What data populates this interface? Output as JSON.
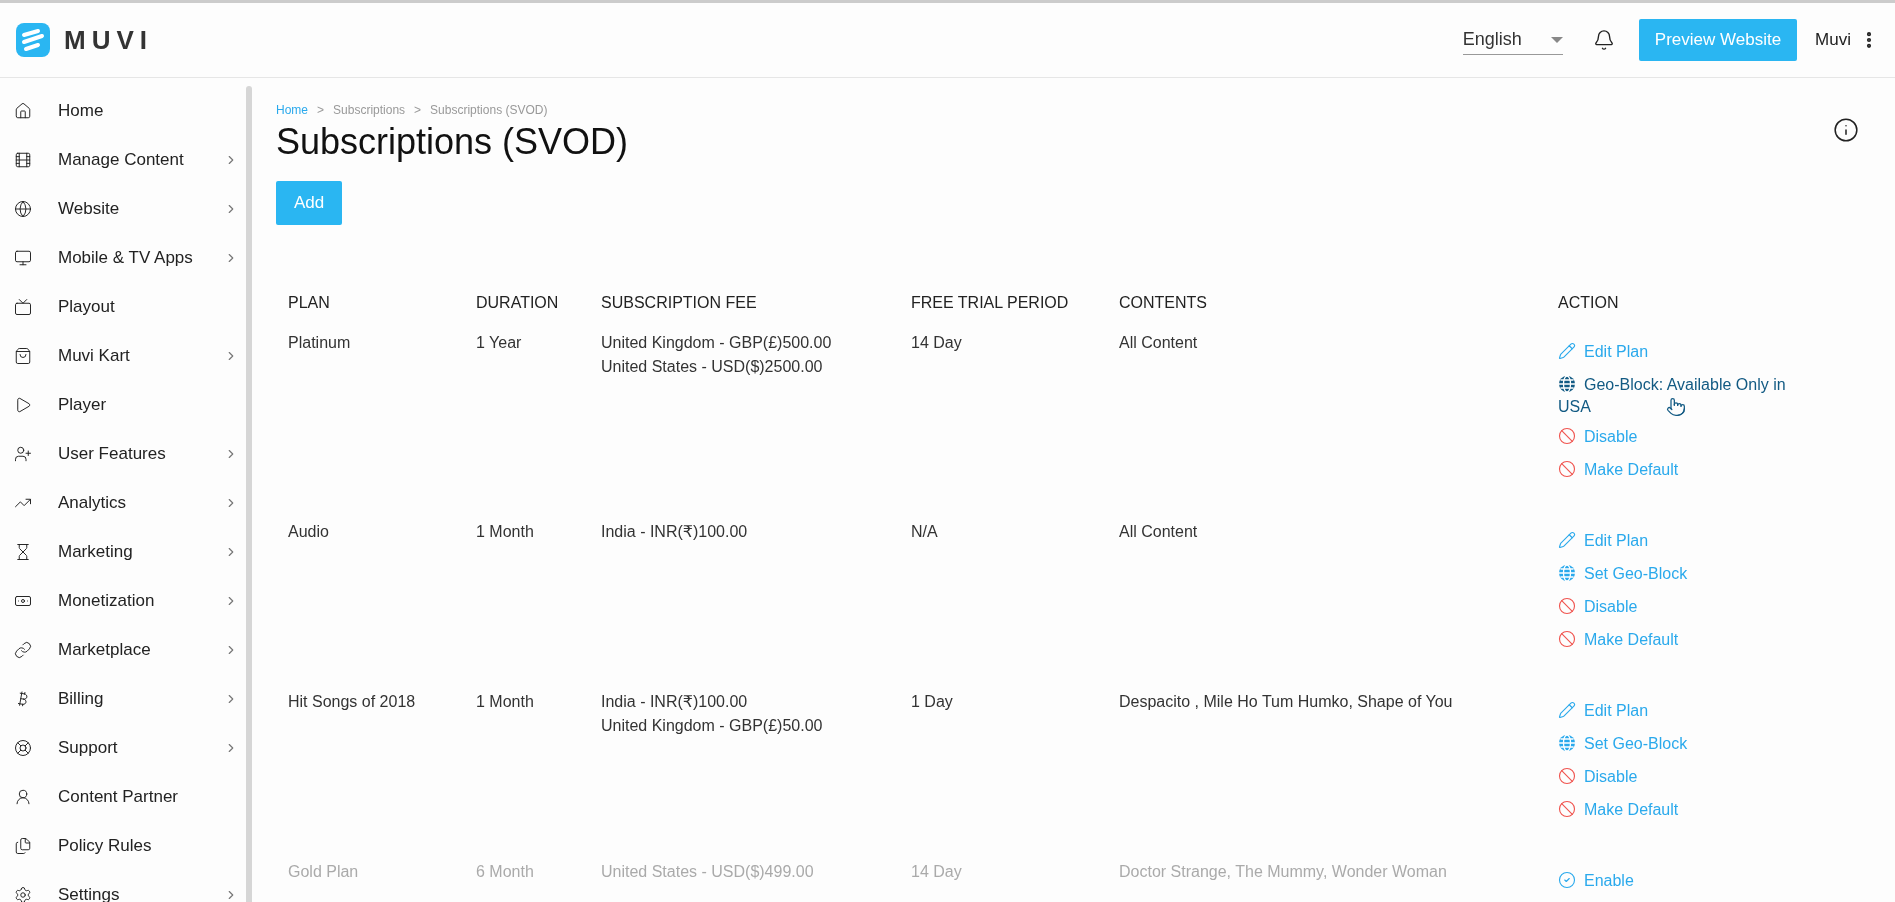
{
  "header": {
    "logo": "MUVI",
    "language": "English",
    "preview_button": "Preview Website",
    "user": "Muvi"
  },
  "sidebar": {
    "items": [
      {
        "label": "Home",
        "has_submenu": false
      },
      {
        "label": "Manage Content",
        "has_submenu": true
      },
      {
        "label": "Website",
        "has_submenu": true
      },
      {
        "label": "Mobile & TV Apps",
        "has_submenu": true
      },
      {
        "label": "Playout",
        "has_submenu": false
      },
      {
        "label": "Muvi Kart",
        "has_submenu": true
      },
      {
        "label": "Player",
        "has_submenu": false
      },
      {
        "label": "User Features",
        "has_submenu": true
      },
      {
        "label": "Analytics",
        "has_submenu": true
      },
      {
        "label": "Marketing",
        "has_submenu": true
      },
      {
        "label": "Monetization",
        "has_submenu": true
      },
      {
        "label": "Marketplace",
        "has_submenu": true
      },
      {
        "label": "Billing",
        "has_submenu": true
      },
      {
        "label": "Support",
        "has_submenu": true
      },
      {
        "label": "Content Partner",
        "has_submenu": false
      },
      {
        "label": "Policy Rules",
        "has_submenu": false
      },
      {
        "label": "Settings",
        "has_submenu": true
      }
    ]
  },
  "breadcrumb": [
    {
      "label": "Home",
      "link": true
    },
    {
      "label": "Subscriptions",
      "link": false
    },
    {
      "label": "Subscriptions (SVOD)",
      "link": false
    }
  ],
  "breadcrumb_separator": ">",
  "title": "Subscriptions (SVOD)",
  "add_button": "Add",
  "table": {
    "columns": [
      "PLAN",
      "DURATION",
      "SUBSCRIPTION FEE",
      "FREE TRIAL PERIOD",
      "CONTENTS",
      "ACTION"
    ],
    "rows": [
      {
        "plan": "Platinum",
        "duration": "1 Year",
        "fees": [
          "United Kingdom - GBP(£)500.00",
          "United States - USD($)2500.00"
        ],
        "trial": "14 Day",
        "contents": "All Content",
        "disabled": false,
        "actions": [
          {
            "kind": "edit",
            "label": "Edit Plan",
            "highlighted": false
          },
          {
            "kind": "geo",
            "label": "Geo-Block: Available Only in USA",
            "highlighted": true
          },
          {
            "kind": "block",
            "label": "Disable",
            "highlighted": false
          },
          {
            "kind": "block",
            "label": "Make Default",
            "highlighted": false
          }
        ]
      },
      {
        "plan": "Audio",
        "duration": "1 Month",
        "fees": [
          "India - INR(₹)100.00"
        ],
        "trial": "N/A",
        "contents": "All Content",
        "disabled": false,
        "actions": [
          {
            "kind": "edit",
            "label": "Edit Plan",
            "highlighted": false
          },
          {
            "kind": "geo",
            "label": "Set Geo-Block",
            "highlighted": false
          },
          {
            "kind": "block",
            "label": "Disable",
            "highlighted": false
          },
          {
            "kind": "block",
            "label": "Make Default",
            "highlighted": false
          }
        ]
      },
      {
        "plan": "Hit Songs of 2018",
        "duration": "1 Month",
        "fees": [
          "India - INR(₹)100.00",
          "United Kingdom - GBP(£)50.00"
        ],
        "trial": "1 Day",
        "contents": "Despacito , Mile Ho Tum Humko, Shape of You",
        "disabled": false,
        "actions": [
          {
            "kind": "edit",
            "label": "Edit Plan",
            "highlighted": false
          },
          {
            "kind": "geo",
            "label": "Set Geo-Block",
            "highlighted": false
          },
          {
            "kind": "block",
            "label": "Disable",
            "highlighted": false
          },
          {
            "kind": "block",
            "label": "Make Default",
            "highlighted": false
          }
        ]
      },
      {
        "plan": "Gold Plan",
        "duration": "6 Month",
        "fees": [
          "United States - USD($)499.00"
        ],
        "trial": "14 Day",
        "contents": "Doctor Strange, The Mummy, Wonder Woman",
        "disabled": true,
        "actions": [
          {
            "kind": "enable",
            "label": "Enable",
            "highlighted": false
          }
        ]
      }
    ]
  }
}
